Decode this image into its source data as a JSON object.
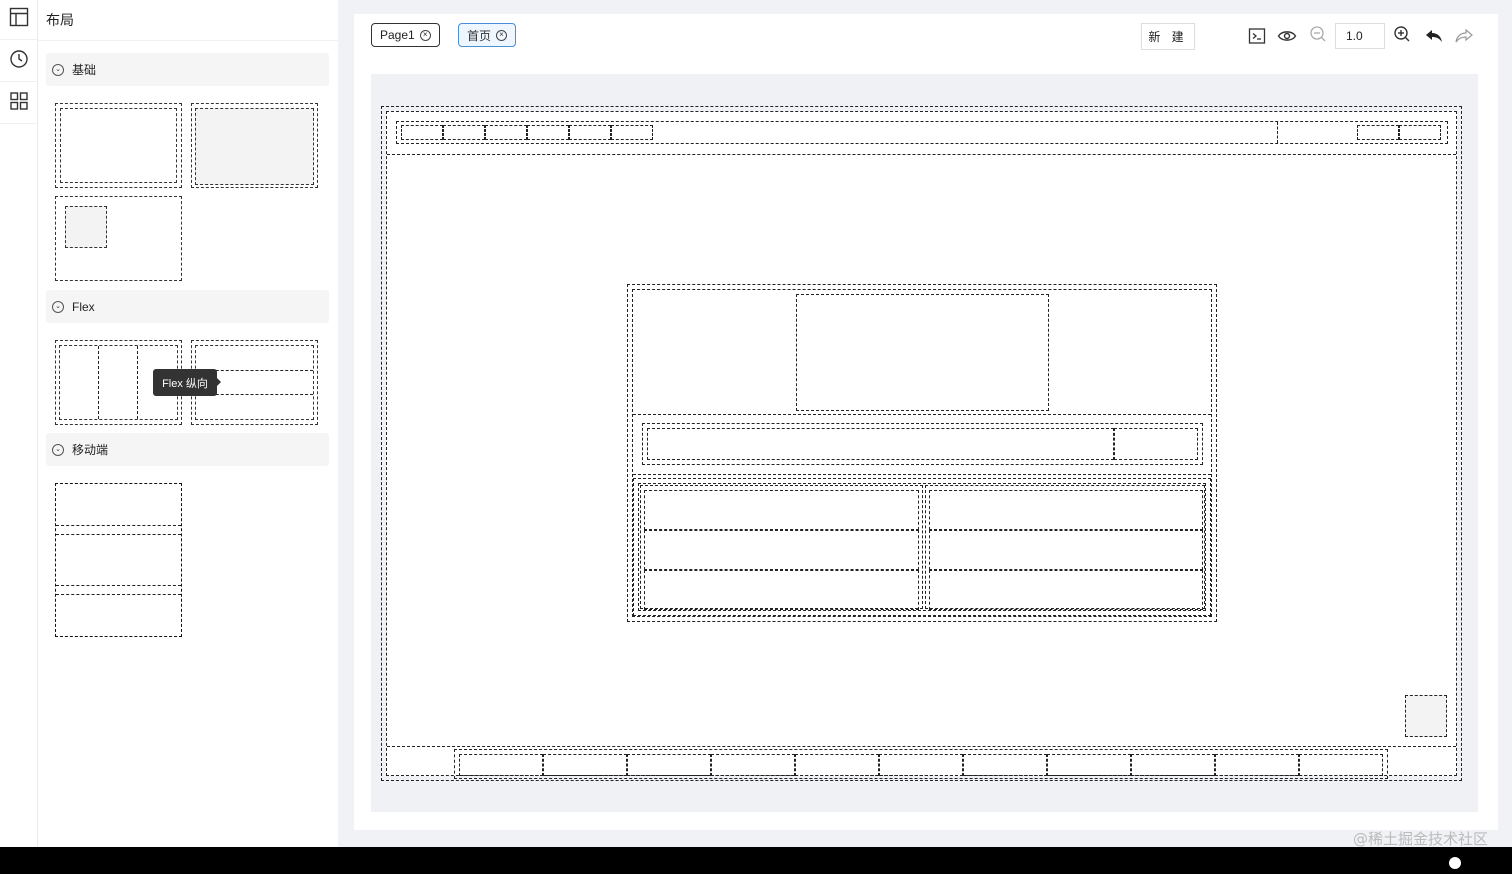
{
  "panel": {
    "title": "布局"
  },
  "groups": [
    {
      "label": "基础"
    },
    {
      "label": "Flex"
    },
    {
      "label": "移动端"
    }
  ],
  "tooltip": "Flex 纵向",
  "tabs": [
    {
      "label": "Page1"
    },
    {
      "label": "首页"
    }
  ],
  "toolbar": {
    "new_label": "新 建",
    "zoom": "1.0"
  },
  "watermark": "@稀土掘金技术社区",
  "icons": [
    "layout-icon",
    "history-icon",
    "grid-icon",
    "terminal-icon",
    "preview-icon",
    "zoom-out-icon",
    "zoom-in-icon",
    "undo-icon",
    "redo-icon"
  ]
}
